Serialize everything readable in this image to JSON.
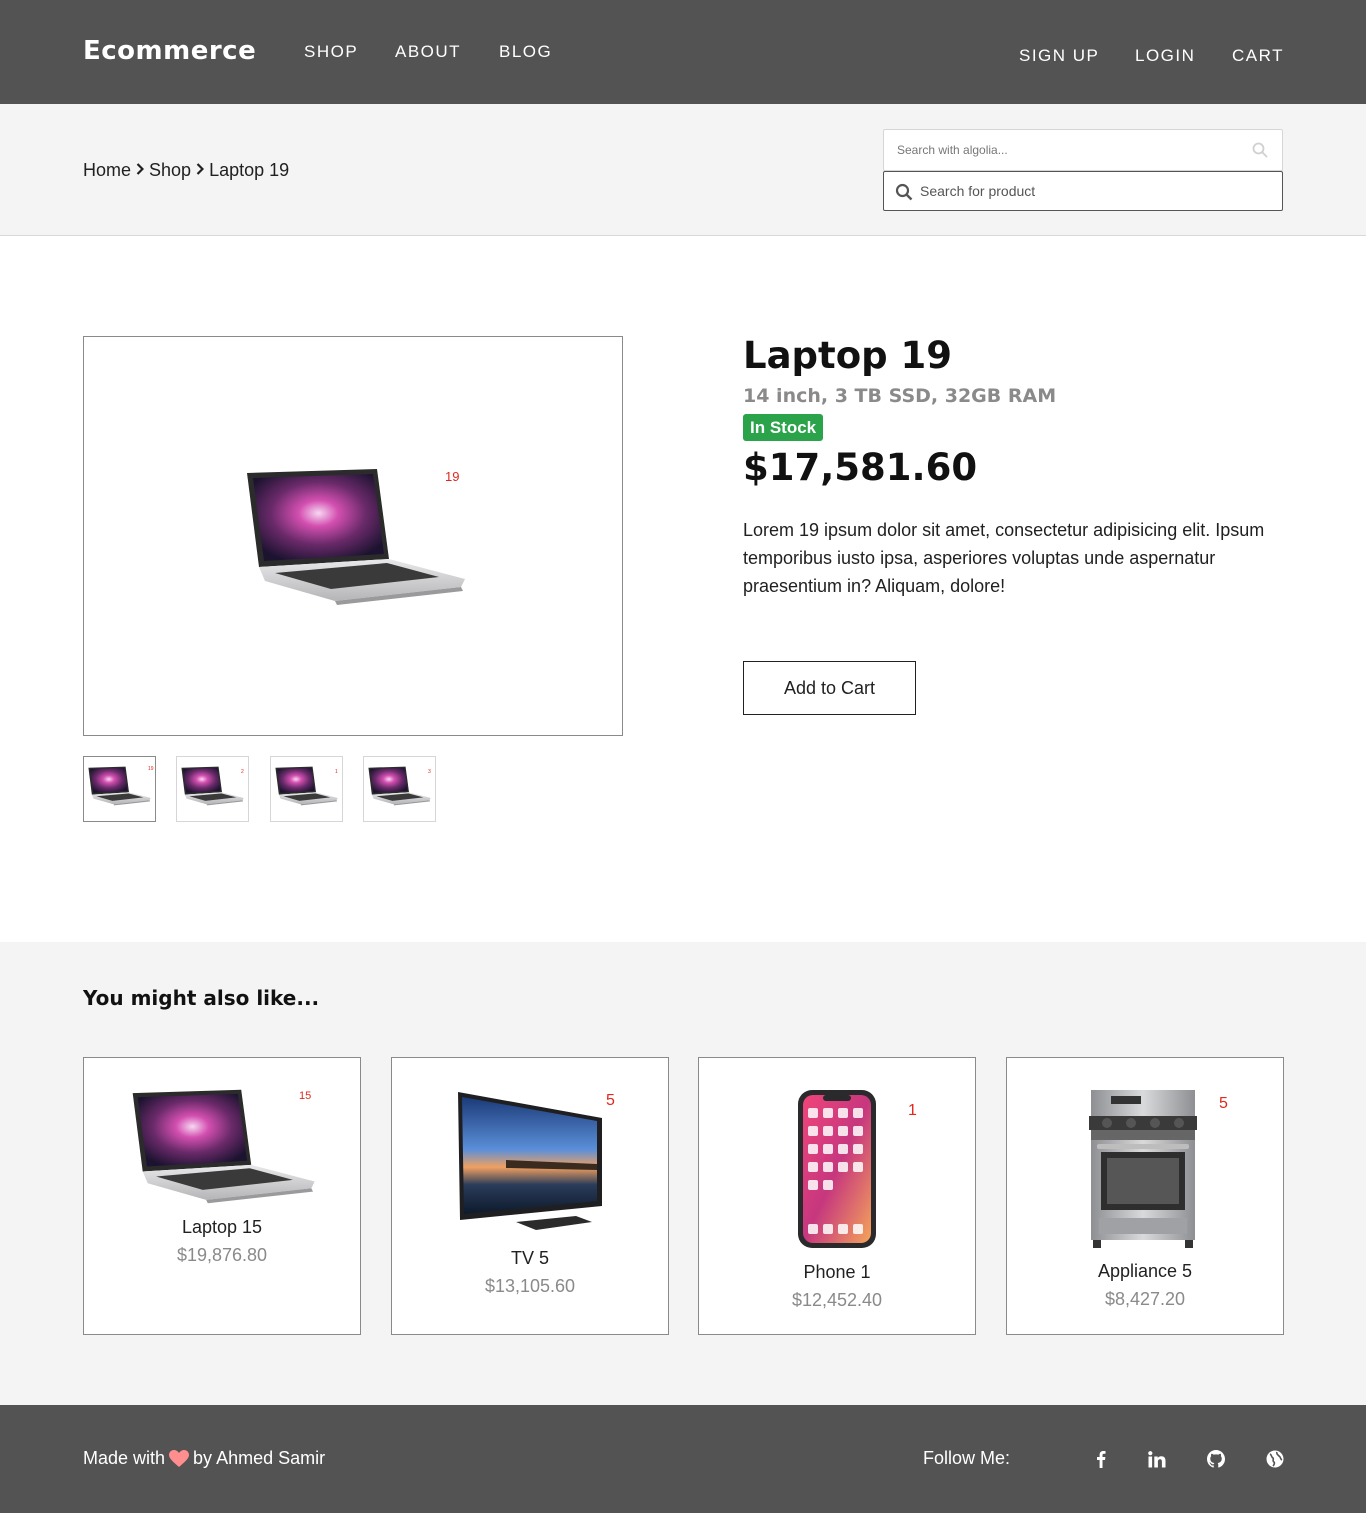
{
  "header": {
    "logo": "Ecommerce",
    "nav_left": [
      "SHOP",
      "ABOUT",
      "BLOG"
    ],
    "nav_right": [
      "SIGN UP",
      "LOGIN",
      "CART"
    ]
  },
  "breadcrumb": {
    "home": "Home",
    "shop": "Shop",
    "current": "Laptop 19"
  },
  "search": {
    "algolia_placeholder": "Search with algolia...",
    "product_placeholder": "Search for product"
  },
  "product": {
    "image_label": "19",
    "title": "Laptop 19",
    "details": "14 inch, 3 TB SSD, 32GB RAM",
    "stock": "In Stock",
    "price": "$17,581.60",
    "description": "Lorem 19 ipsum dolor sit amet, consectetur adipisicing elit. Ipsum temporibus iusto ipsa, asperiores voluptas unde aspernatur praesentium in? Aliquam, dolore!",
    "add_to_cart": "Add to Cart",
    "thumb_labels": [
      "19",
      "2",
      "1",
      "3"
    ]
  },
  "related": {
    "title": "You might also like...",
    "items": [
      {
        "name": "Laptop 15",
        "price": "$19,876.80",
        "label": "15",
        "icon": "laptop-icon"
      },
      {
        "name": "TV 5",
        "price": "$13,105.60",
        "label": "5",
        "icon": "tv-icon"
      },
      {
        "name": "Phone 1",
        "price": "$12,452.40",
        "label": "1",
        "icon": "phone-icon"
      },
      {
        "name": "Appliance 5",
        "price": "$8,427.20",
        "label": "5",
        "icon": "stove-icon"
      }
    ]
  },
  "footer": {
    "made_with": "Made with",
    "by": "by Ahmed Samir",
    "follow": "Follow Me:",
    "social": [
      "facebook-icon",
      "linkedin-icon",
      "github-icon",
      "globe-icon"
    ]
  },
  "colors": {
    "header_bg": "#535353",
    "band_bg": "#f4f4f4",
    "stock_green": "#2aa34a",
    "label_red": "#e0281e",
    "heart": "#ff8e8e"
  }
}
